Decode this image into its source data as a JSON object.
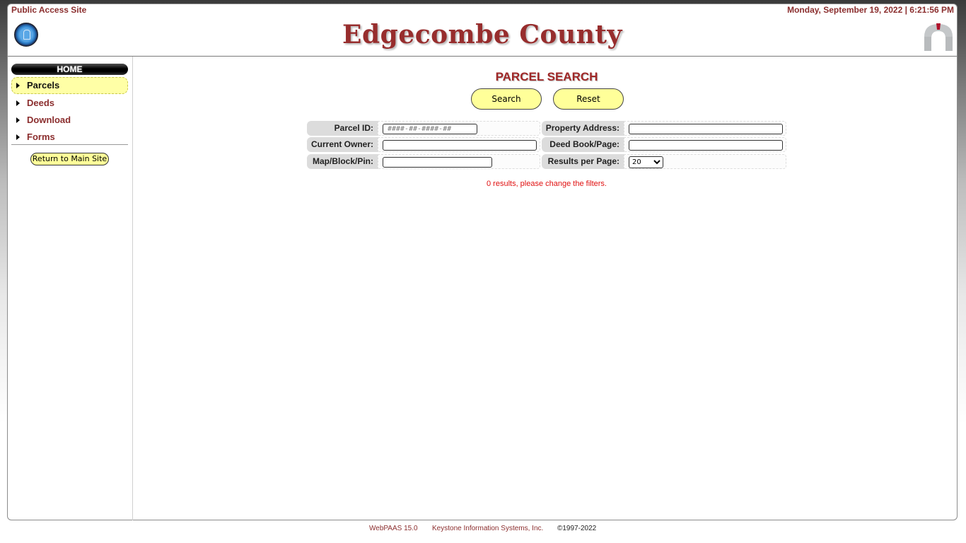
{
  "header": {
    "site_label": "Public Access Site",
    "datetime": "Monday, September 19, 2022 | 6:21:56 PM",
    "title": "Edgecombe County",
    "seal_icon": "county-seal-icon",
    "arch_icon": "arch-logo-icon"
  },
  "sidebar": {
    "home_label": "HOME",
    "items": [
      {
        "label": "Parcels",
        "active": true
      },
      {
        "label": "Deeds",
        "active": false
      },
      {
        "label": "Download",
        "active": false
      },
      {
        "label": "Forms",
        "active": false
      }
    ],
    "return_label": "Return to Main Site"
  },
  "main": {
    "heading": "PARCEL SEARCH",
    "search_label": "Search",
    "reset_label": "Reset",
    "fields": {
      "parcel_id": {
        "label": "Parcel ID:",
        "value": "",
        "placeholder": "####-##-####-##"
      },
      "property_address": {
        "label": "Property Address:",
        "value": ""
      },
      "current_owner": {
        "label": "Current Owner:",
        "value": ""
      },
      "deed_book_page": {
        "label": "Deed Book/Page:",
        "value": ""
      },
      "map_block_pin": {
        "label": "Map/Block/Pin:",
        "value": ""
      },
      "results_per_page": {
        "label": "Results per Page:",
        "selected": "20"
      }
    },
    "status_message": "0 results, please change the filters."
  },
  "footer": {
    "version": "WebPAAS 15.0",
    "company": "Keystone Information Systems, Inc.",
    "copyright": "©1997-2022"
  },
  "colors": {
    "brand_red": "#972d2d",
    "highlight_yellow": "#ffff99",
    "error_red": "#e01010"
  }
}
